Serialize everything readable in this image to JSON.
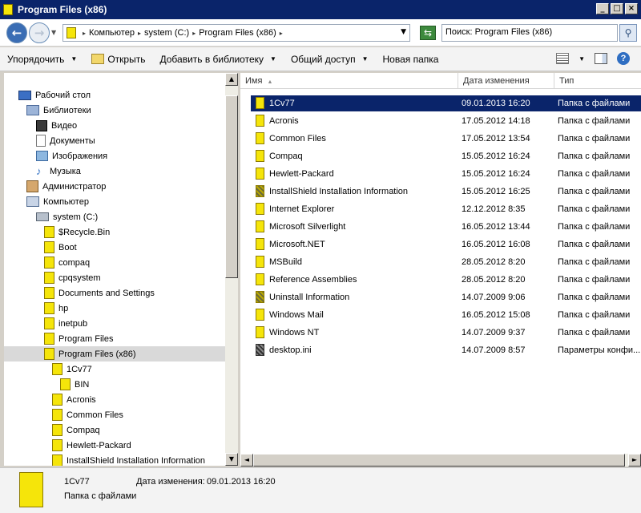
{
  "window": {
    "title": "Program Files (x86)",
    "min_label": "_",
    "max_label": "□",
    "close_label": "×"
  },
  "address": {
    "back_glyph": "←",
    "fwd_glyph": "→",
    "crumbs": [
      "Компьютер",
      "system (C:)",
      "Program Files (x86)"
    ],
    "refresh_glyph": "⇆",
    "search_placeholder": "Поиск: Program Files (x86)",
    "search_glyph": "⚲"
  },
  "toolbar": {
    "organize": "Упорядочить",
    "open": "Открыть",
    "add_library": "Добавить в библиотеку",
    "share": "Общий доступ",
    "new_folder": "Новая папка",
    "help": "?"
  },
  "nav": {
    "items": [
      {
        "label": "Рабочий стол",
        "icon": "desktop-icon"
      },
      {
        "label": "Библиотеки",
        "icon": "libraries-icon"
      },
      {
        "label": "Видео",
        "icon": "video-icon"
      },
      {
        "label": "Документы",
        "icon": "documents-icon"
      },
      {
        "label": "Изображения",
        "icon": "pictures-icon"
      },
      {
        "label": "Музыка",
        "icon": "music-icon"
      },
      {
        "label": "Администратор",
        "icon": "user-icon"
      },
      {
        "label": "Компьютер",
        "icon": "computer-icon"
      },
      {
        "label": "system (C:)",
        "icon": "drive-icon"
      },
      {
        "label": "$Recycle.Bin",
        "icon": "folder-icon"
      },
      {
        "label": "Boot",
        "icon": "folder-icon"
      },
      {
        "label": "compaq",
        "icon": "folder-icon"
      },
      {
        "label": "cpqsystem",
        "icon": "folder-icon"
      },
      {
        "label": "Documents and Settings",
        "icon": "folder-icon"
      },
      {
        "label": "hp",
        "icon": "folder-icon"
      },
      {
        "label": "inetpub",
        "icon": "folder-icon"
      },
      {
        "label": "Program Files",
        "icon": "folder-icon"
      },
      {
        "label": "Program Files (x86)",
        "icon": "folder-icon"
      },
      {
        "label": "1Cv77",
        "icon": "folder-icon"
      },
      {
        "label": "BIN",
        "icon": "folder-icon"
      },
      {
        "label": "Acronis",
        "icon": "folder-icon"
      },
      {
        "label": "Common Files",
        "icon": "folder-icon"
      },
      {
        "label": "Compaq",
        "icon": "folder-icon"
      },
      {
        "label": "Hewlett-Packard",
        "icon": "folder-icon"
      },
      {
        "label": "InstallShield Installation Information",
        "icon": "folder-icon"
      }
    ]
  },
  "list": {
    "columns": {
      "name": "Имя",
      "date": "Дата изменения",
      "type": "Тип"
    },
    "rows": [
      {
        "name": "1Cv77",
        "date": "09.01.2013 16:20",
        "type": "Папка с файлами",
        "kind": "folder"
      },
      {
        "name": "Acronis",
        "date": "17.05.2012 14:18",
        "type": "Папка с файлами",
        "kind": "folder"
      },
      {
        "name": "Common Files",
        "date": "17.05.2012 13:54",
        "type": "Папка с файлами",
        "kind": "folder"
      },
      {
        "name": "Compaq",
        "date": "15.05.2012 16:24",
        "type": "Папка с файлами",
        "kind": "folder"
      },
      {
        "name": "Hewlett-Packard",
        "date": "15.05.2012 16:24",
        "type": "Папка с файлами",
        "kind": "folder"
      },
      {
        "name": "InstallShield Installation Information",
        "date": "15.05.2012 16:25",
        "type": "Папка с файлами",
        "kind": "hidden"
      },
      {
        "name": "Internet Explorer",
        "date": "12.12.2012 8:35",
        "type": "Папка с файлами",
        "kind": "folder"
      },
      {
        "name": "Microsoft Silverlight",
        "date": "16.05.2012 13:44",
        "type": "Папка с файлами",
        "kind": "folder"
      },
      {
        "name": "Microsoft.NET",
        "date": "16.05.2012 16:08",
        "type": "Папка с файлами",
        "kind": "folder"
      },
      {
        "name": "MSBuild",
        "date": "28.05.2012 8:20",
        "type": "Папка с файлами",
        "kind": "folder"
      },
      {
        "name": "Reference Assemblies",
        "date": "28.05.2012 8:20",
        "type": "Папка с файлами",
        "kind": "folder"
      },
      {
        "name": "Uninstall Information",
        "date": "14.07.2009 9:06",
        "type": "Папка с файлами",
        "kind": "hidden"
      },
      {
        "name": "Windows Mail",
        "date": "16.05.2012 15:08",
        "type": "Папка с файлами",
        "kind": "folder"
      },
      {
        "name": "Windows NT",
        "date": "14.07.2009 9:37",
        "type": "Папка с файлами",
        "kind": "folder"
      },
      {
        "name": "desktop.ini",
        "date": "14.07.2009 8:57",
        "type": "Параметры конфи...",
        "kind": "ini"
      }
    ]
  },
  "details": {
    "name": "1Cv77",
    "type": "Папка с файлами",
    "date_label": "Дата изменения:",
    "date_value": "09.01.2013 16:20"
  },
  "colors": {
    "selection": "#0a246a",
    "folder": "#f5e50a",
    "nav_selected": "#d9d9d9"
  }
}
